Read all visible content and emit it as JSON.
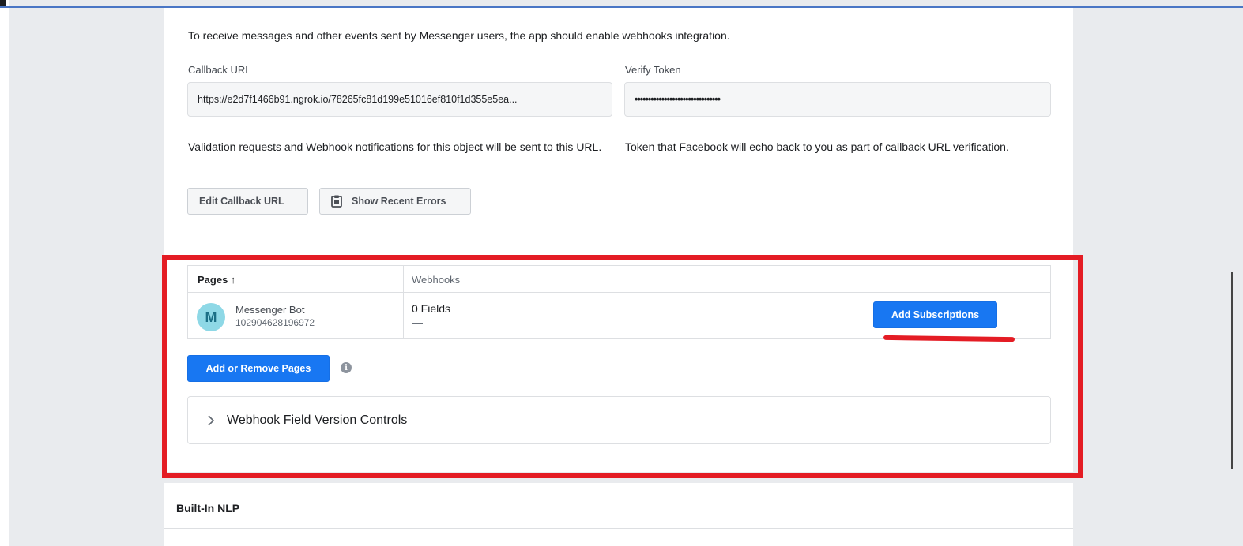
{
  "webhooks": {
    "intro_text": "To receive messages and other events sent by Messenger users, the app should enable webhooks integration.",
    "callback_url_label": "Callback URL",
    "callback_url_value": "https://e2d7f1466b91.ngrok.io/78265fc81d199e51016ef810f1d355e5ea...",
    "verify_token_label": "Verify Token",
    "verify_token_value": "••••••••••••••••••••••••••••••••",
    "callback_url_help": "Validation requests and Webhook notifications for this object will be sent to this URL.",
    "verify_token_help": "Token that Facebook will echo back to you as part of callback URL verification.",
    "edit_callback_label": "Edit Callback URL",
    "show_errors_label": "Show Recent Errors"
  },
  "pages_table": {
    "col_pages": "Pages ↑",
    "col_webhooks": "Webhooks",
    "rows": [
      {
        "avatar_letter": "M",
        "page_name": "Messenger Bot",
        "page_id": "102904628196972",
        "fields_count": "0 Fields",
        "fields_detail": "—",
        "action_label": "Add Subscriptions"
      }
    ]
  },
  "add_remove_pages_label": "Add or Remove Pages",
  "info_icon": "i",
  "version_controls_label": "Webhook Field Version Controls",
  "builtin_nlp_title": "Built-In NLP",
  "colors": {
    "primary_blue": "#1877f2",
    "annotation_red": "#e41c24",
    "background": "#e9ebee"
  },
  "icons": {
    "clipboard": "clipboard-icon",
    "chevron": "chevron-right-icon",
    "info": "info-icon",
    "sort": "arrow-up"
  }
}
